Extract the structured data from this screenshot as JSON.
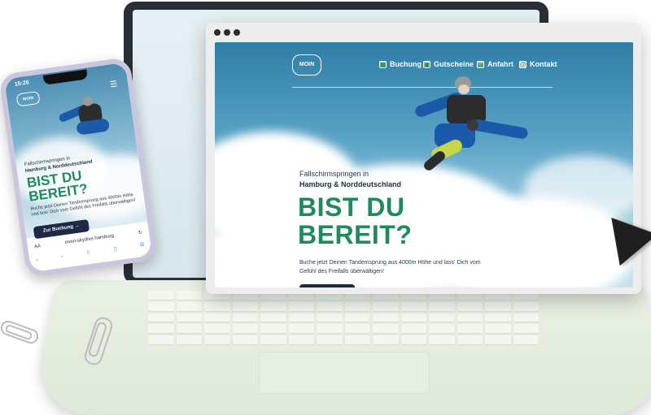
{
  "site": {
    "logo_text": "MOIN",
    "nav": [
      {
        "label": "Buchung",
        "icon": "calendar-icon"
      },
      {
        "label": "Gutscheine",
        "icon": "gift-icon"
      },
      {
        "label": "Anfahrt",
        "icon": "map-icon"
      },
      {
        "label": "Kontakt",
        "icon": "at-icon"
      }
    ],
    "hero": {
      "subtitle_line1": "Fallschirmspringen in",
      "subtitle_line2": "Hamburg & Norddeutschland",
      "title_line1": "BIST DU",
      "title_line2": "BEREIT?",
      "description": "Buche jetzt Deinen Tandemsprung aus 4000m Höhe und lass' Dich vom Gefühl des Freifalls überwältigen!"
    }
  },
  "phone": {
    "time": "15:26",
    "logo_text": "MOIN",
    "menu_icon": "☰",
    "subtitle_line1": "Fallschirmspringen in",
    "subtitle_line2": "Hamburg & Norddeutschland",
    "title_line1": "BIST DU",
    "title_line2": "BEREIT?",
    "description": "Buche jetzt Deinen Tandemsprung aus 4000m Höhe und lass' Dich vom Gefühl des Freifalls überwältigen!",
    "cta": "Zur Buchung →",
    "url_prefix": "AA",
    "url": "moin-skydive.hamburg"
  },
  "colors": {
    "accent_green": "#1f8b5c",
    "button_navy": "#1e2a44"
  }
}
